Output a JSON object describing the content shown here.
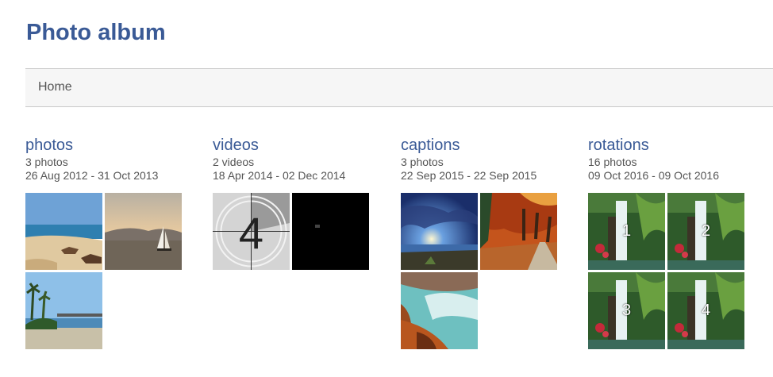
{
  "page_title": "Photo album",
  "breadcrumb": {
    "home_label": "Home"
  },
  "albums": [
    {
      "name": "photos",
      "count": "3 photos",
      "dates": "26 Aug 2012 - 31 Oct 2013"
    },
    {
      "name": "videos",
      "count": "2 videos",
      "dates": "18 Apr 2014 - 02 Dec 2014",
      "countdown_digit": "4"
    },
    {
      "name": "captions",
      "count": "3 photos",
      "dates": "22 Sep 2015 - 22 Sep 2015"
    },
    {
      "name": "rotations",
      "count": "16 photos",
      "dates": "09 Oct 2016 - 09 Oct 2016",
      "thumb_numbers": [
        "1",
        "2",
        "3",
        "4"
      ]
    }
  ],
  "colors": {
    "title": "#3a5a96",
    "link": "#3a5a96",
    "meta_text": "#555555",
    "bar_bg": "#f6f6f6"
  }
}
